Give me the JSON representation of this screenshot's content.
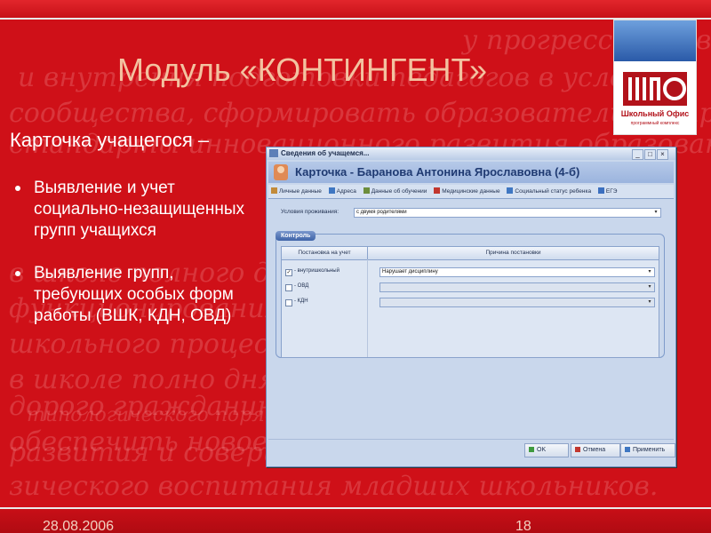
{
  "slide": {
    "title": "Модуль «КОНТИНГЕНТ»",
    "subtitle": "Карточка учащегося –",
    "bullets": [
      "Выявление и учет социально-незащищенных групп учащихся",
      "Выявление групп, требующих особых форм работы (ВШК, КДН, ОВД)"
    ],
    "date": "28.08.2006",
    "page_number": "18",
    "logo_text": "Школьный Офис",
    "logo_subtext": "программный комплекс",
    "background_script_lines": [
      "у прогрессивно, возможно вполне обоснованно обеспечи",
      "и внутрення подготовки педагогов в условиях",
      "сообщества, сформировать образовательное пр",
      "стандарты инновационного развития образования",
      "в школе полного дня, внедрение новых",
      "функционирования системы образования",
      "школьного процесса и совершенствования",
      "в школе полно дня в условиях обучения,",
      "дорого гражданина России",
      "обеспечить новое качество",
      "типологического порядка",
      "развития и совершенствования",
      "зического воспитания младших школьников."
    ],
    "colors": {
      "background": "#cf1018",
      "title": "#f3c2a0",
      "text": "#ffffff"
    }
  },
  "window": {
    "title": "Сведения об учащемся...",
    "controls": [
      "_",
      "□",
      "×"
    ],
    "header": "Карточка - Баранова Антонина Ярославовна (4-б)",
    "tabs": [
      "Личные данные",
      "Адреса",
      "Данные об обучении",
      "Медицинские данные",
      "Социальный статус ребенка",
      "ЕГЭ"
    ],
    "living_conditions_label": "Условия проживания:",
    "living_conditions_value": "с двумя родителями",
    "group_label": "Контроль",
    "grid_headers": [
      "Постановка на учет",
      "Причина постановки"
    ],
    "rows": [
      {
        "label": "- внутришкольный",
        "checked": true,
        "reason": "Нарушает дисциплину"
      },
      {
        "label": "- ОВД",
        "checked": false,
        "reason": ""
      },
      {
        "label": "- КДН",
        "checked": false,
        "reason": ""
      }
    ],
    "buttons": {
      "ok": "OK",
      "cancel": "Отмена",
      "apply": "Применить"
    }
  }
}
